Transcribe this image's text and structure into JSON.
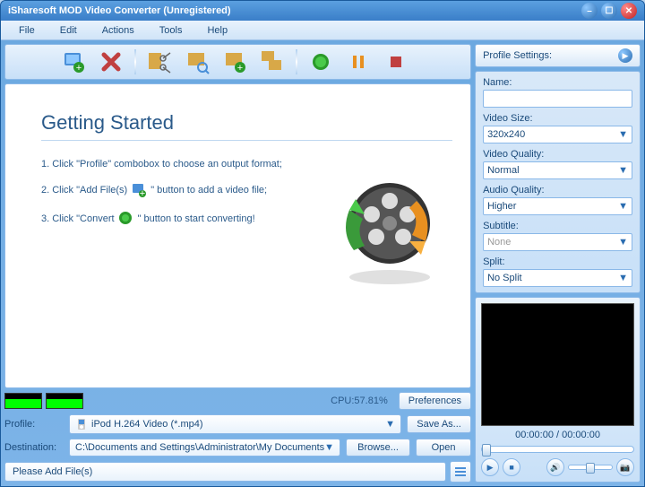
{
  "titlebar": {
    "title": "iSharesoft MOD Video Converter (Unregistered)"
  },
  "menu": {
    "file": "File",
    "edit": "Edit",
    "actions": "Actions",
    "tools": "Tools",
    "help": "Help"
  },
  "toolbar": {
    "icons": [
      "add-file",
      "remove",
      "cut",
      "crop",
      "effect",
      "merge",
      "convert",
      "pause",
      "stop"
    ]
  },
  "getting_started": {
    "heading": "Getting Started",
    "step1_a": "1. Click \"Profile\" combobox to choose an output format;",
    "step2_a": "2. Click \"Add File(s)",
    "step2_b": "\" button to add a video file;",
    "step3_a": "3. Click \"Convert",
    "step3_b": "\" button to start converting!"
  },
  "cpu": {
    "label": "CPU:57.81%"
  },
  "buttons": {
    "preferences": "Preferences",
    "save_as": "Save As...",
    "browse": "Browse...",
    "open": "Open"
  },
  "profile": {
    "label": "Profile:",
    "value": "iPod H.264 Video (*.mp4)"
  },
  "destination": {
    "label": "Destination:",
    "value": "C:\\Documents and Settings\\Administrator\\My Documents"
  },
  "status": {
    "text": "Please Add File(s)"
  },
  "settings": {
    "header": "Profile Settings:",
    "name_label": "Name:",
    "name_value": "",
    "video_size_label": "Video Size:",
    "video_size_value": "320x240",
    "video_quality_label": "Video Quality:",
    "video_quality_value": "Normal",
    "audio_quality_label": "Audio Quality:",
    "audio_quality_value": "Higher",
    "subtitle_label": "Subtitle:",
    "subtitle_value": "None",
    "split_label": "Split:",
    "split_value": "No Split"
  },
  "preview": {
    "time": "00:00:00 / 00:00:00"
  }
}
